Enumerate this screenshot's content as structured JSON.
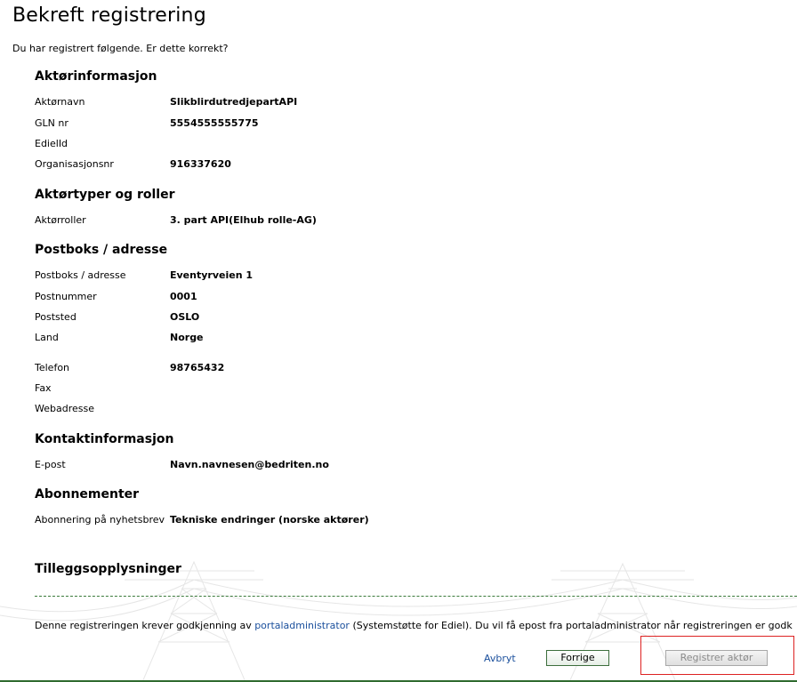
{
  "page": {
    "title": "Bekreft registrering",
    "intro": "Du har registrert følgende. Er dette korrekt?"
  },
  "sections": {
    "actor_info": {
      "heading": "Aktørinformasjon",
      "actor_name_label": "Aktørnavn",
      "actor_name_value": "SlikblirdutredjepartAPI",
      "gln_label": "GLN nr",
      "gln_value": "5554555555775",
      "ediel_label": "EdielId",
      "ediel_value": "",
      "orgnr_label": "Organisasjonsnr",
      "orgnr_value": "916337620"
    },
    "roles": {
      "heading": "Aktørtyper og roller",
      "roles_label": "Aktørroller",
      "roles_value": "3. part API(Elhub rolle-AG)"
    },
    "address": {
      "heading": "Postboks / adresse",
      "address_label": "Postboks / adresse",
      "address_value": "Eventyrveien 1",
      "postal_code_label": "Postnummer",
      "postal_code_value": "0001",
      "city_label": "Poststed",
      "city_value": "OSLO",
      "country_label": "Land",
      "country_value": "Norge",
      "phone_label": "Telefon",
      "phone_value": "98765432",
      "fax_label": "Fax",
      "fax_value": "",
      "web_label": "Webadresse",
      "web_value": ""
    },
    "contact": {
      "heading": "Kontaktinformasjon",
      "email_label": "E-post",
      "email_value": "Navn.navnesen@bedriten.no"
    },
    "subscriptions": {
      "heading": "Abonnementer",
      "newsletter_label": "Abonnering på nyhetsbrev",
      "newsletter_value": "Tekniske endringer (norske aktører)"
    },
    "additional": {
      "heading": "Tilleggsopplysninger"
    }
  },
  "note": {
    "prefix": "Denne registreringen krever godkjenning av ",
    "link": "portaladministrator",
    "suffix": " (Systemstøtte for Ediel). Du vil få epost fra portaladministrator når registreringen er godk"
  },
  "actions": {
    "cancel": "Avbryt",
    "previous": "Forrige",
    "register": "Registrer aktør"
  },
  "colors": {
    "link": "#1a4f9c",
    "accent_green": "#2f6b2f",
    "highlight": "#dd2222"
  }
}
